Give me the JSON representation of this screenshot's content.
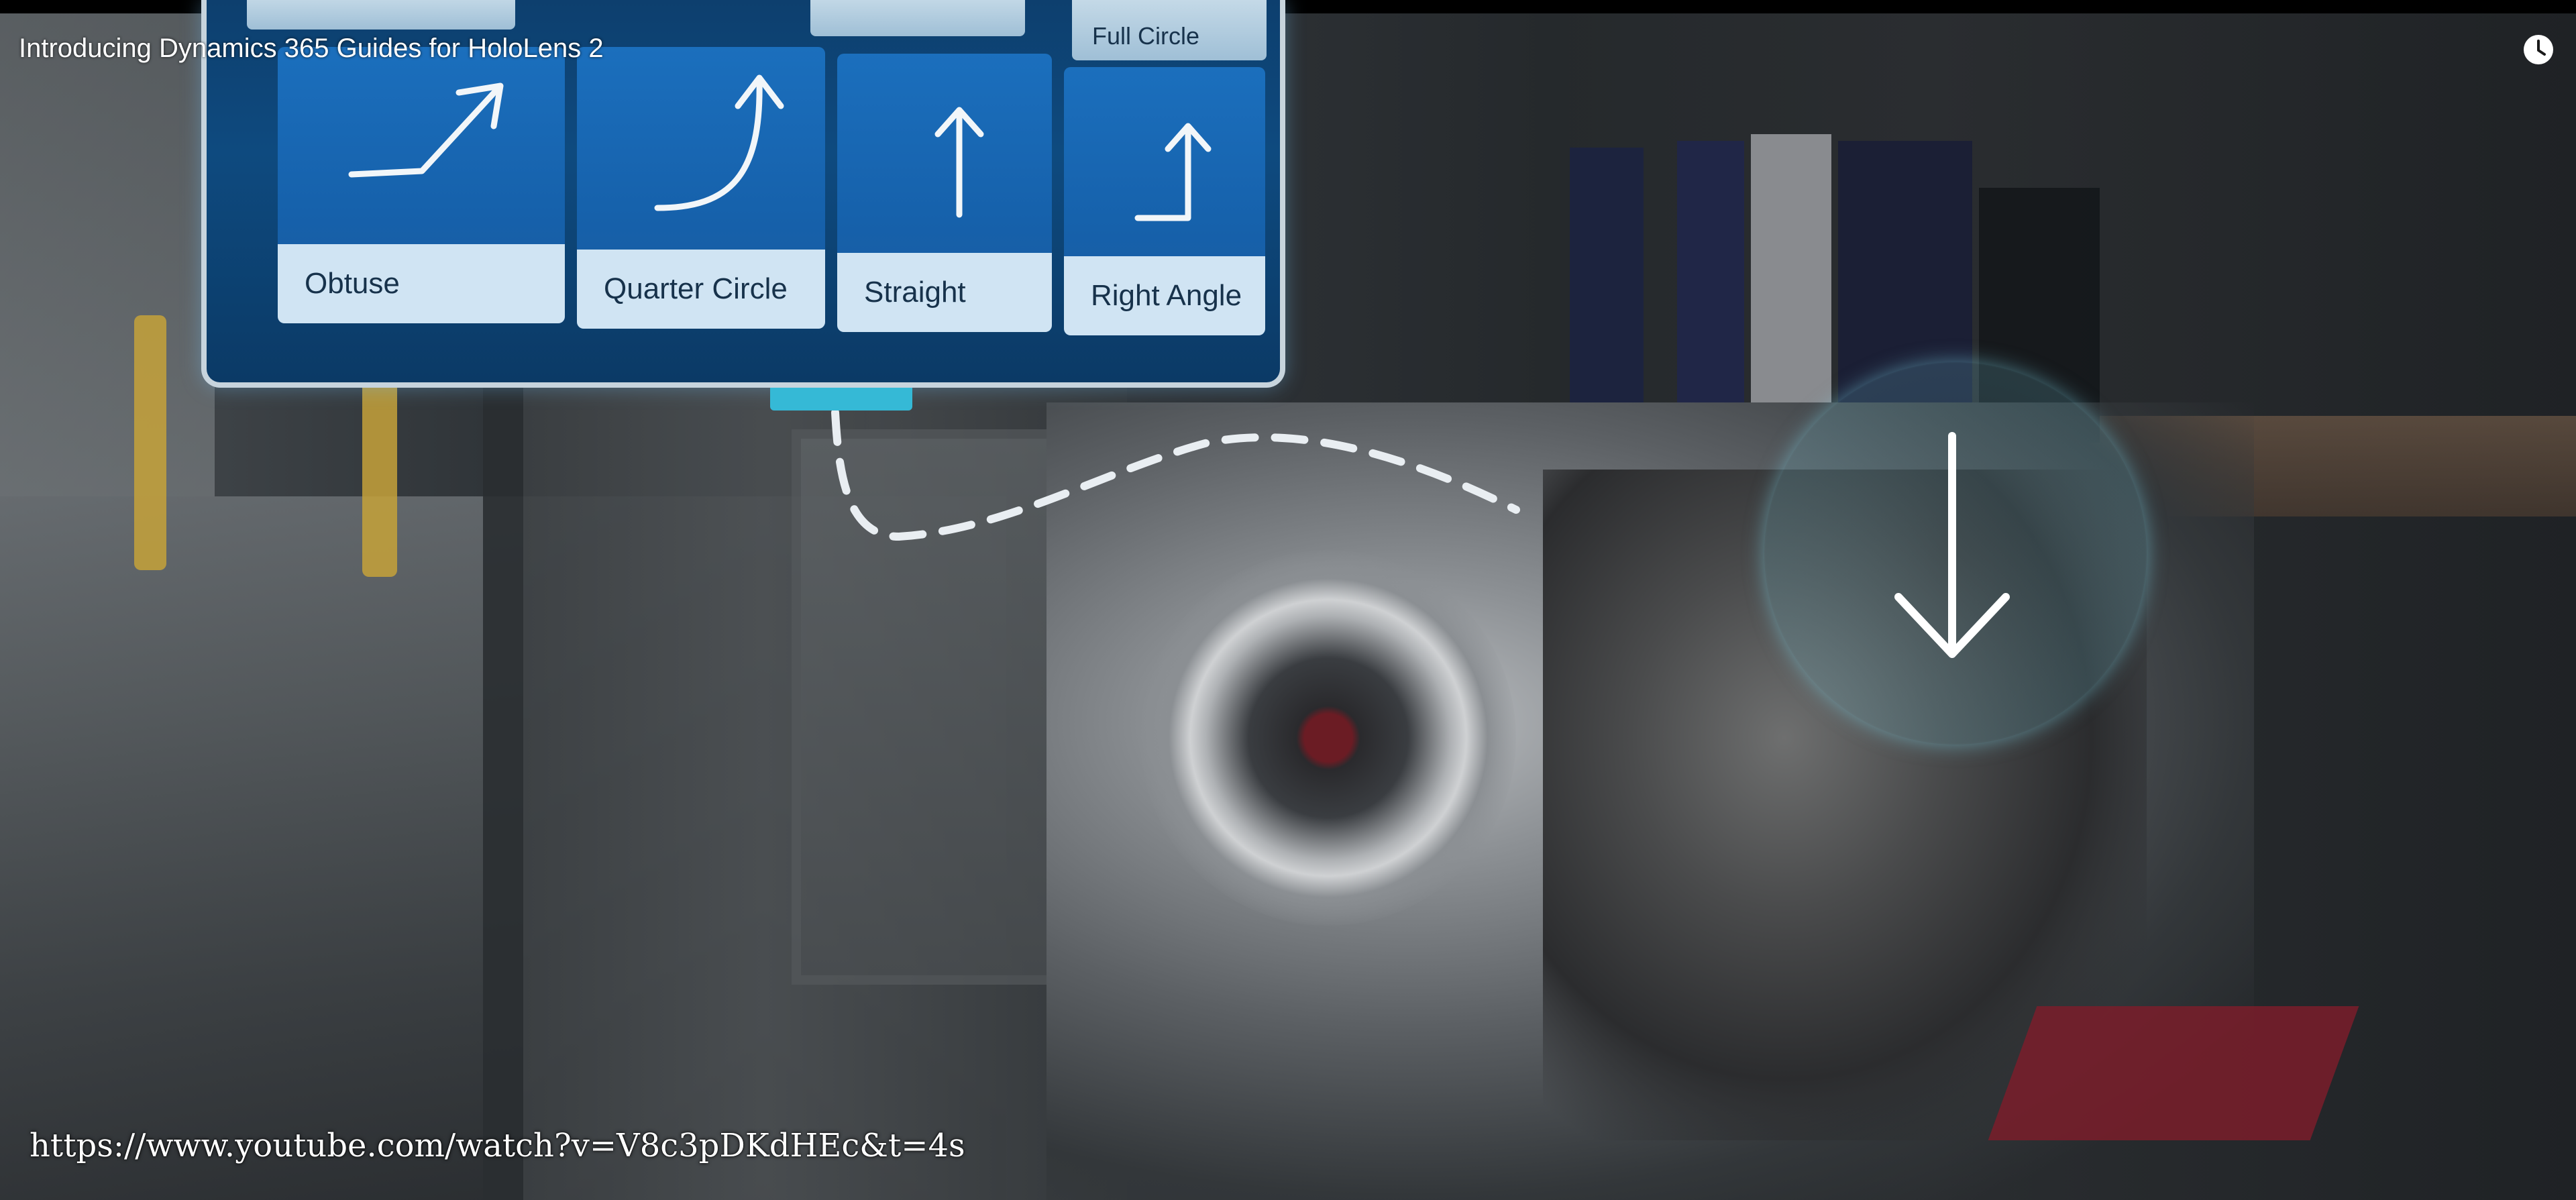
{
  "video": {
    "title": "Introducing Dynamics 365 Guides for HoloLens 2",
    "watch_later_icon": "clock-icon"
  },
  "hologram": {
    "top_row_visible_labels": [
      "",
      "",
      "Full Circle"
    ],
    "tiles": [
      {
        "label": "Obtuse",
        "icon": "obtuse-arrow-icon"
      },
      {
        "label": "Quarter Circle",
        "icon": "quarter-circle-arrow-icon"
      },
      {
        "label": "Straight",
        "icon": "straight-arrow-icon"
      },
      {
        "label": "Right Angle",
        "icon": "right-angle-arrow-icon"
      }
    ],
    "target_icon": "down-arrow-icon",
    "accent_color": "#35b9d6",
    "panel_color": "#0e4a7f"
  },
  "caption": {
    "url": "https://www.youtube.com/watch?v=V8c3pDKdHEc&t=4s"
  }
}
